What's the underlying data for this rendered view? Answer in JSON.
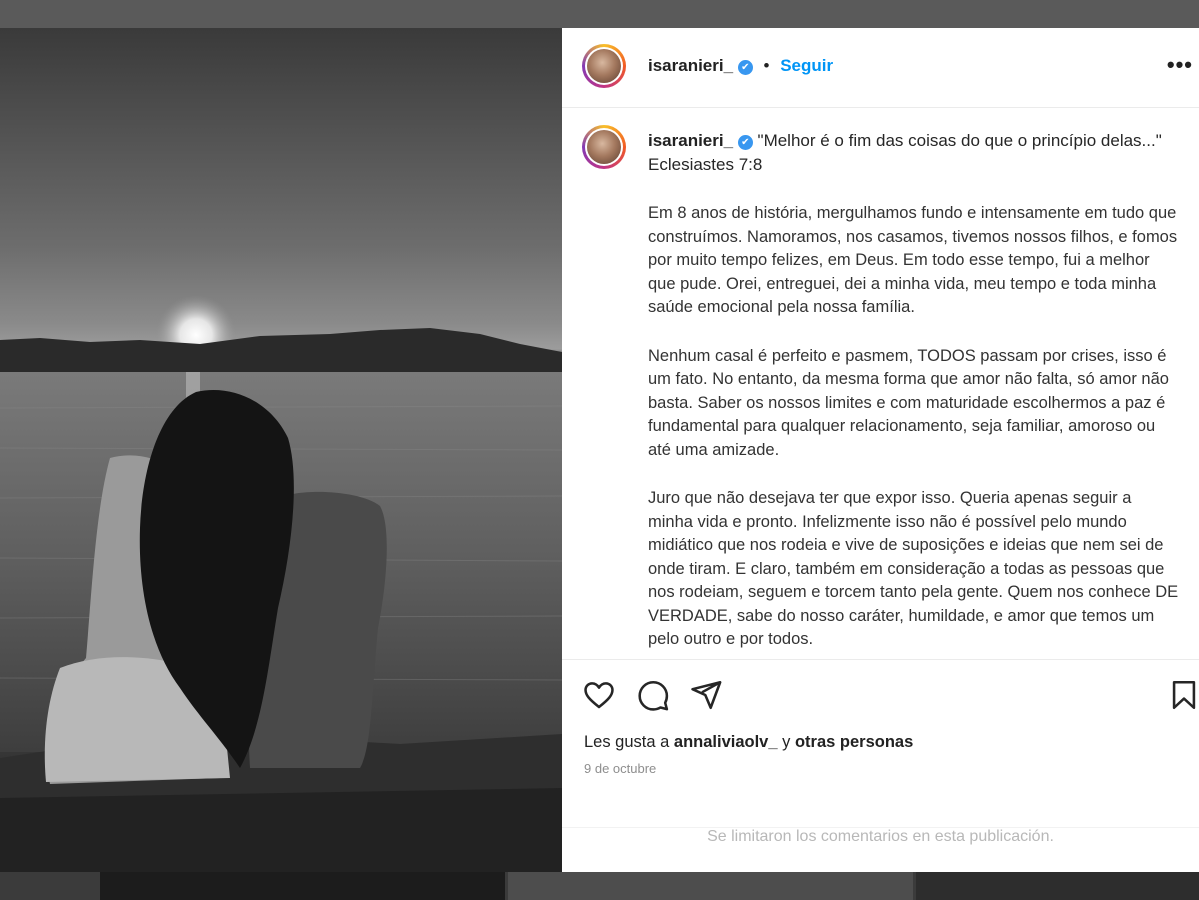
{
  "post": {
    "username": "isaranieri_",
    "verified_glyph": "✔",
    "separator": "•",
    "follow_label": "Seguir",
    "more_label": "•••"
  },
  "caption": {
    "username": "isaranieri_",
    "first_text": "\"Melhor é o fim das coisas do que o princípio delas...\" Eclesiastes 7:8",
    "paragraphs": [
      "Em 8 anos de história, mergulhamos fundo e intensamente em tudo que construímos. Namoramos, nos casamos, tivemos nossos filhos, e fomos por muito tempo felizes, em Deus. Em todo esse tempo, fui a melhor que pude. Orei, entreguei, dei a minha vida, meu tempo e toda minha saúde emocional pela nossa família.",
      "Nenhum casal é perfeito e pasmem, TODOS passam por crises, isso é um fato. No entanto, da mesma forma que amor não falta, só amor não basta. Saber os nossos limites e com maturidade escolhermos a paz é fundamental para qualquer relacionamento, seja familiar, amoroso ou até uma amizade.",
      "Juro que não desejava ter que expor isso. Queria apenas seguir a minha vida e pronto. Infelizmente isso não é possível pelo mundo midiático que nos rodeia e vive de suposições e ideias que nem sei de onde tiram. E claro, também em consideração a todas as pessoas que nos rodeiam, seguem e torcem tanto pela gente. Quem nos conhece DE VERDADE, sabe do nosso caráter, humildade, e amor que temos um pelo outro e por todos."
    ]
  },
  "actions": {
    "icons": [
      "heart-icon",
      "comment-icon",
      "share-icon",
      "bookmark-icon"
    ],
    "likes_prefix": "Les gusta a ",
    "likes_user": "annaliviaolv_",
    "likes_middle": " y ",
    "likes_others": "otras personas",
    "date": "9 de octubre",
    "comments_limited": "Se limitaron los comentarios en esta publicación."
  },
  "colors": {
    "link_blue": "#0095f6",
    "verified_blue": "#3897f0"
  }
}
